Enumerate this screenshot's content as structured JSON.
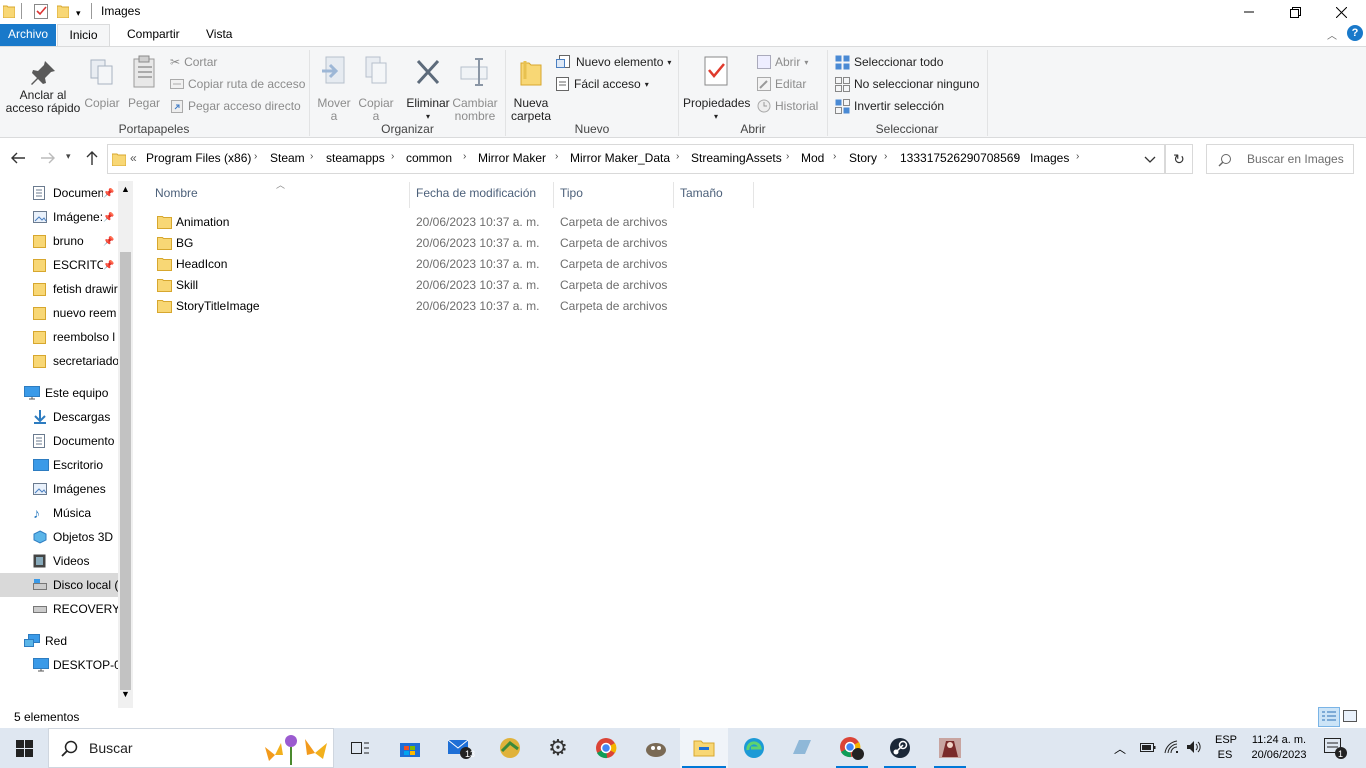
{
  "window": {
    "title": "Images"
  },
  "tabs": [
    "Archivo",
    "Inicio",
    "Compartir",
    "Vista"
  ],
  "ribbon": {
    "clipboard": {
      "label": "Portapapeles",
      "pin": "Anclar al acceso rápido",
      "pin_l1": "Anclar al",
      "pin_l2": "acceso rápido",
      "copy": "Copiar",
      "paste": "Pegar",
      "cut": "Cortar",
      "copy_path": "Copiar ruta de acceso",
      "paste_shortcut": "Pegar acceso directo"
    },
    "organize": {
      "label": "Organizar",
      "move_l1": "Mover",
      "move_l2": "a",
      "copy_l1": "Copiar",
      "copy_l2": "a",
      "delete": "Eliminar",
      "rename_l1": "Cambiar",
      "rename_l2": "nombre"
    },
    "new": {
      "label": "Nuevo",
      "folder_l1": "Nueva",
      "folder_l2": "carpeta",
      "new_item": "Nuevo elemento",
      "easy_access": "Fácil acceso"
    },
    "open": {
      "label": "Abrir",
      "properties": "Propiedades",
      "open": "Abrir",
      "edit": "Editar",
      "history": "Historial"
    },
    "select": {
      "label": "Seleccionar",
      "all": "Seleccionar todo",
      "none": "No seleccionar ninguno",
      "invert": "Invertir selección"
    }
  },
  "address": {
    "overflow": "«",
    "crumbs": [
      "Program Files (x86)",
      "Steam",
      "steamapps",
      "common",
      "Mirror Maker",
      "Mirror Maker_Data",
      "StreamingAssets",
      "Mod",
      "Story",
      "1333175262907085​69",
      "Images"
    ]
  },
  "search": {
    "placeholder": "Buscar en Images"
  },
  "nav": {
    "quick": [
      {
        "label": "Documen",
        "icon": "documents-icon",
        "pinned": true
      },
      {
        "label": "Imágene:",
        "icon": "pictures-icon",
        "pinned": true
      },
      {
        "label": "bruno",
        "icon": "folder-icon",
        "pinned": true
      },
      {
        "label": "ESCRITOF",
        "icon": "folder-icon",
        "pinned": true
      },
      {
        "label": "fetish drawir",
        "icon": "folder-icon",
        "pinned": false
      },
      {
        "label": "nuevo reem",
        "icon": "folder-icon",
        "pinned": false
      },
      {
        "label": "reembolso l",
        "icon": "folder-icon",
        "pinned": false
      },
      {
        "label": "secretariado",
        "icon": "folder-icon",
        "pinned": false
      }
    ],
    "this_pc": "Este equipo",
    "pc_items": [
      {
        "label": "Descargas",
        "icon": "downloads-icon"
      },
      {
        "label": "Documento",
        "icon": "documents-icon"
      },
      {
        "label": "Escritorio",
        "icon": "desktop-icon"
      },
      {
        "label": "Imágenes",
        "icon": "pictures-icon"
      },
      {
        "label": "Música",
        "icon": "music-icon"
      },
      {
        "label": "Objetos 3D",
        "icon": "3d-objects-icon"
      },
      {
        "label": "Videos",
        "icon": "videos-icon"
      },
      {
        "label": "Disco local (",
        "icon": "drive-icon"
      },
      {
        "label": "RECOVERY (",
        "icon": "drive-icon"
      }
    ],
    "network": "Red",
    "net_items": [
      {
        "label": "DESKTOP-0H",
        "icon": "computer-icon"
      }
    ]
  },
  "columns": {
    "name": "Nombre",
    "date": "Fecha de modificación",
    "type": "Tipo",
    "size": "Tamaño"
  },
  "files": [
    {
      "name": "Animation",
      "date": "20/06/2023 10:37 a. m.",
      "type": "Carpeta de archivos"
    },
    {
      "name": "BG",
      "date": "20/06/2023 10:37 a. m.",
      "type": "Carpeta de archivos"
    },
    {
      "name": "HeadIcon",
      "date": "20/06/2023 10:37 a. m.",
      "type": "Carpeta de archivos"
    },
    {
      "name": "Skill",
      "date": "20/06/2023 10:37 a. m.",
      "type": "Carpeta de archivos"
    },
    {
      "name": "StoryTitleImage",
      "date": "20/06/2023 10:37 a. m.",
      "type": "Carpeta de archivos"
    }
  ],
  "status": {
    "count": "5 elementos"
  },
  "taskbar": {
    "search": "Buscar",
    "mail_badge": "13",
    "lang1": "ESP",
    "lang2": "ES",
    "time": "11:24 a. m.",
    "date": "20/06/2023",
    "notif_badge": "1"
  },
  "colors": {
    "accent": "#1979ca",
    "folder": "#f8d775",
    "taskbar": "#dfe7f1"
  }
}
